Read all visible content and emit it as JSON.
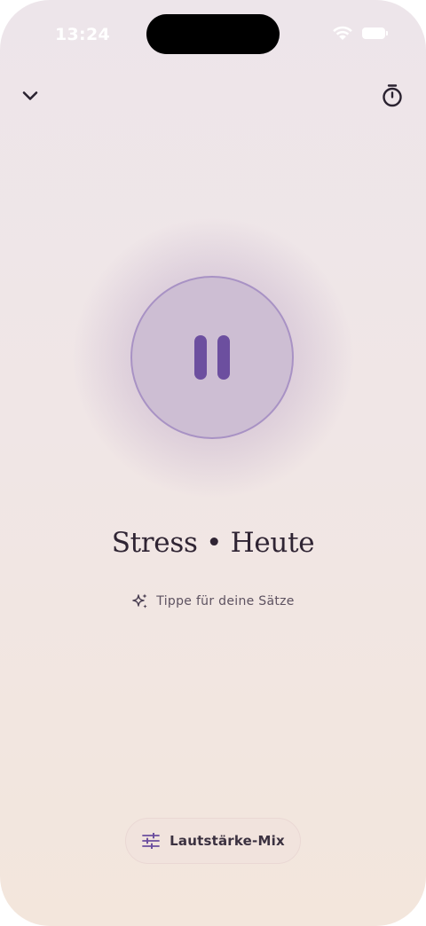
{
  "status_bar": {
    "time": "13:24"
  },
  "header": {
    "left_icon": "chevron-down-icon",
    "right_icon": "stopwatch-icon"
  },
  "player": {
    "state_icon": "pause-icon",
    "title": "Stress • Heute",
    "hint_icon": "sparkles-icon",
    "hint": "Tippe für deine Sätze"
  },
  "footer": {
    "mix_icon": "sliders-icon",
    "mix_label": "Lautstärke-Mix"
  },
  "colors": {
    "accent": "#6c4f9f",
    "accent_ring": "#a892c4",
    "circle_fill": "#cdbed3",
    "text_primary": "#2f2433"
  }
}
